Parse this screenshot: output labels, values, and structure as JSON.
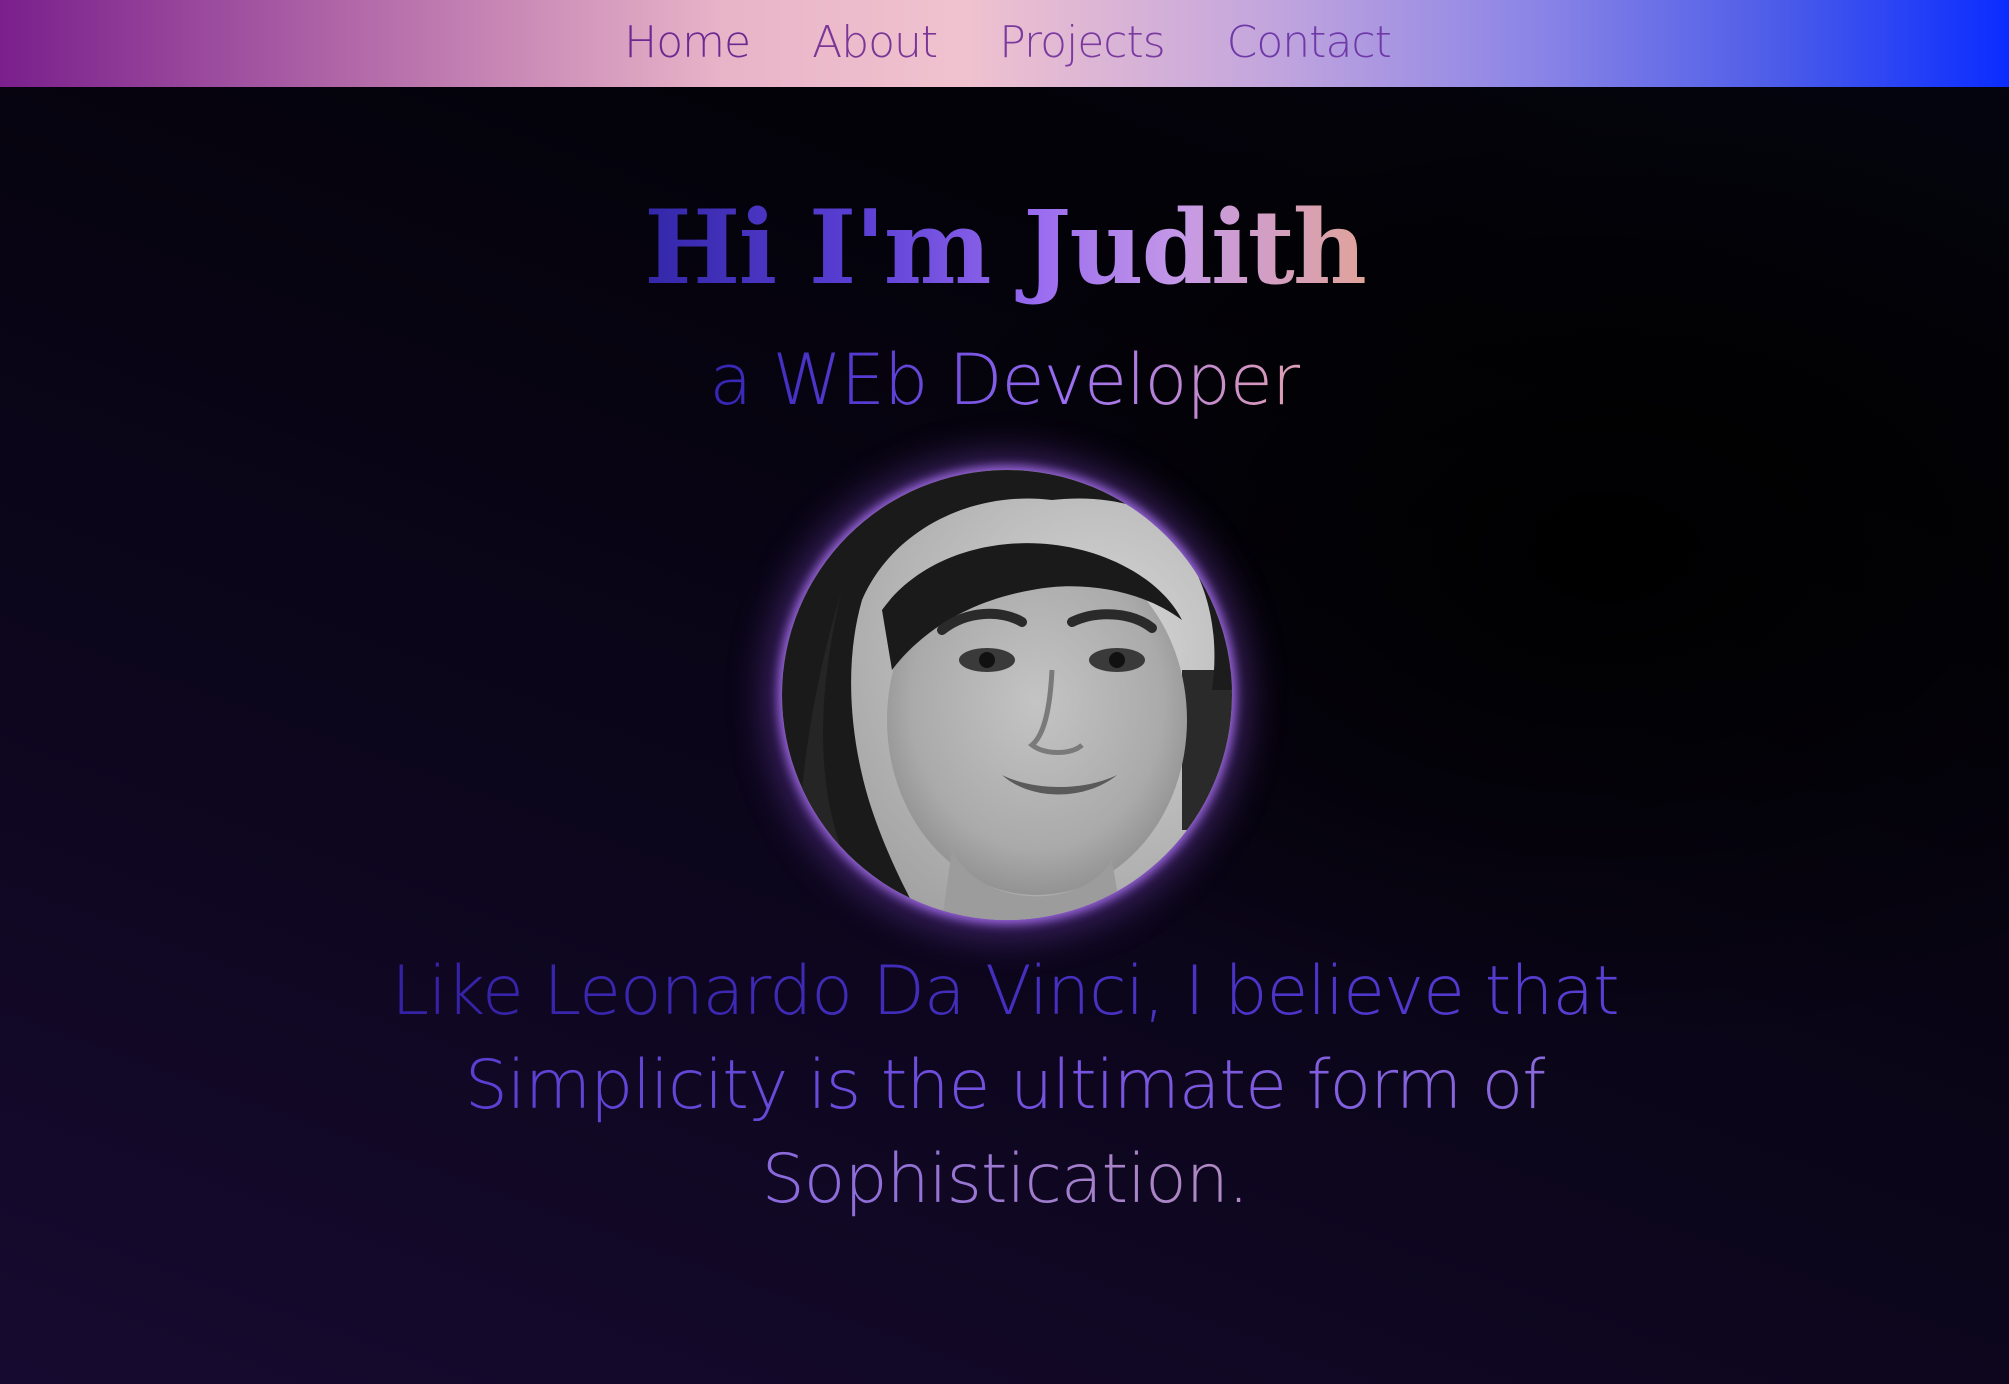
{
  "nav": {
    "items": [
      {
        "label": "Home"
      },
      {
        "label": "About"
      },
      {
        "label": "Projects"
      },
      {
        "label": "Contact"
      }
    ]
  },
  "hero": {
    "title": "Hi I'm Judith",
    "subtitle": "a WEb Developer",
    "quote": "Like Leonardo Da Vinci, I believe that Simplicity is the ultimate form of Sophistication."
  },
  "colors": {
    "nav_gradient_start": "#7a1f8c",
    "nav_gradient_mid": "#f0c2cf",
    "nav_gradient_end": "#0a2cff",
    "accent_purple": "#9a6cf0",
    "background": "#000000"
  },
  "avatar": {
    "icon": "profile-photo"
  }
}
